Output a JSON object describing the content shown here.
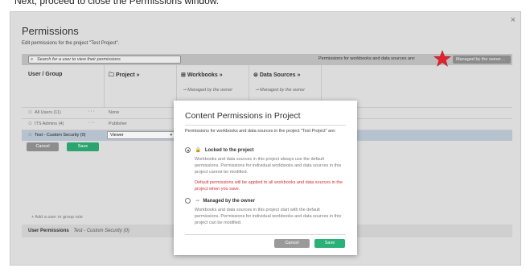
{
  "top_caption": "Next, proceed to close the Permissions window.",
  "window": {
    "title": "Permissions",
    "subtitle": "Edit permissions for the project \"Test Project\".",
    "close": "×"
  },
  "toolbar": {
    "search_placeholder": "Search for a user to view their permissions",
    "wb_ds_label": "Permissions for workbooks and data sources are:",
    "managed_button": "Managed by the owner…",
    "accent_star": "#e0232f"
  },
  "columns": {
    "user_group": "User / Group",
    "project": "Project",
    "workbooks": "Workbooks",
    "workbooks_sub": "Managed by the owner",
    "data_sources": "Data Sources",
    "data_sources_sub": "Managed by the owner"
  },
  "rows": [
    {
      "name": "All Users (11)",
      "project": "None",
      "icon": "group-icon"
    },
    {
      "name": "ITS Admins (4)",
      "project": "Publisher",
      "icon": "group-icon"
    },
    {
      "name": "Test - Custom Security (0)",
      "project": "Viewer",
      "icon": "group-icon",
      "selected": true
    }
  ],
  "row_actions": {
    "cancel": "Cancel",
    "save": "Save"
  },
  "add_rule": "+ Add a user or group rule",
  "user_permissions": {
    "label": "User Permissions",
    "value": "Test - Custom Security (0)"
  },
  "dialog": {
    "title": "Content Permissions in Project",
    "intro": "Permissions for workbooks and data sources in the project \"Test Project\" are:",
    "option_locked": {
      "title": "Locked to the project",
      "desc": "Workbooks and data sources in this project always use the default permissions. Permissions for individual workbooks and data sources in this project cannot be modified.",
      "warning": "Default permissions will be applied to all workbooks and data sources in the project when you save."
    },
    "option_owner": {
      "title": "Managed by the owner",
      "desc": "Workbooks and data sources in this project start with the default permissions. Permissions for individual workbooks and data sources in this project can be modified."
    },
    "cancel": "Cancel",
    "save": "Save"
  }
}
